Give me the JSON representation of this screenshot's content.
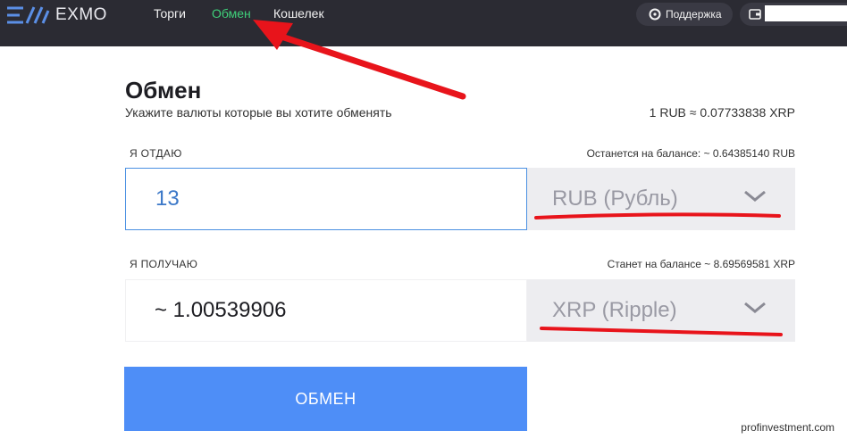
{
  "header": {
    "logo_text": "EXMO",
    "nav": [
      {
        "label": "Торги",
        "active": false
      },
      {
        "label": "Обмен",
        "active": true
      },
      {
        "label": "Кошелек",
        "active": false
      }
    ],
    "support_label": "Поддержка"
  },
  "exchange": {
    "title": "Обмен",
    "subtitle": "Укажите валюты которые вы хотите обменять",
    "rate": "1 RUB ≈ 0.07733838 XRP",
    "give": {
      "label": "Я ОТДАЮ",
      "balance": "Останется на балансе: ~ 0.64385140 RUB",
      "amount": "13",
      "currency": "RUB (Рубль)"
    },
    "get": {
      "label": "Я ПОЛУЧАЮ",
      "balance": "Станет на балансе ~ 8.69569581 XRP",
      "amount": "~ 1.00539906",
      "currency": "XRP (Ripple)"
    },
    "button_label": "ОБМЕН"
  },
  "watermark": "profinvestment.com",
  "colors": {
    "topbar": "#2b2b33",
    "active_nav": "#3fd07a",
    "button": "#4e8ef7",
    "annotation": "#e8141b"
  }
}
